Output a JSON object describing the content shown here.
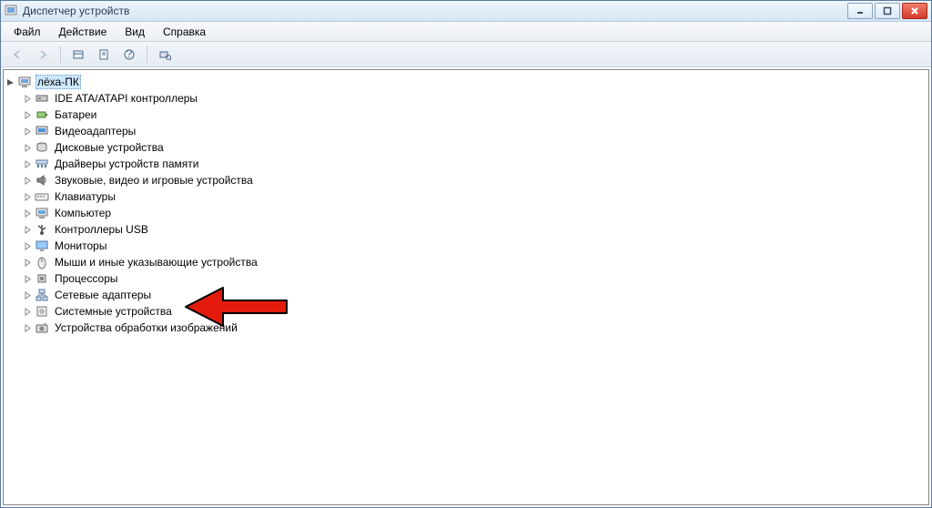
{
  "title": "Диспетчер устройств",
  "menu": [
    "Файл",
    "Действие",
    "Вид",
    "Справка"
  ],
  "toolbar": {
    "back": "←",
    "forward": "→",
    "properties": "⧉",
    "help": "?"
  },
  "root": "лёха-ПК",
  "nodes": [
    {
      "label": "IDE ATA/ATAPI контроллеры",
      "icon": "ide"
    },
    {
      "label": "Батареи",
      "icon": "battery"
    },
    {
      "label": "Видеоадаптеры",
      "icon": "display"
    },
    {
      "label": "Дисковые устройства",
      "icon": "disk"
    },
    {
      "label": "Драйверы устройств памяти",
      "icon": "memory"
    },
    {
      "label": "Звуковые, видео и игровые устройства",
      "icon": "audio"
    },
    {
      "label": "Клавиатуры",
      "icon": "keyboard"
    },
    {
      "label": "Компьютер",
      "icon": "computer"
    },
    {
      "label": "Контроллеры USB",
      "icon": "usb"
    },
    {
      "label": "Мониторы",
      "icon": "monitor"
    },
    {
      "label": "Мыши и иные указывающие устройства",
      "icon": "mouse"
    },
    {
      "label": "Процессоры",
      "icon": "cpu"
    },
    {
      "label": "Сетевые адаптеры",
      "icon": "network"
    },
    {
      "label": "Системные устройства",
      "icon": "system"
    },
    {
      "label": "Устройства обработки изображений",
      "icon": "imaging"
    }
  ],
  "arrow_target_index": 12,
  "colors": {
    "arrow_fill": "#e31b0c",
    "arrow_stroke": "#000000"
  }
}
